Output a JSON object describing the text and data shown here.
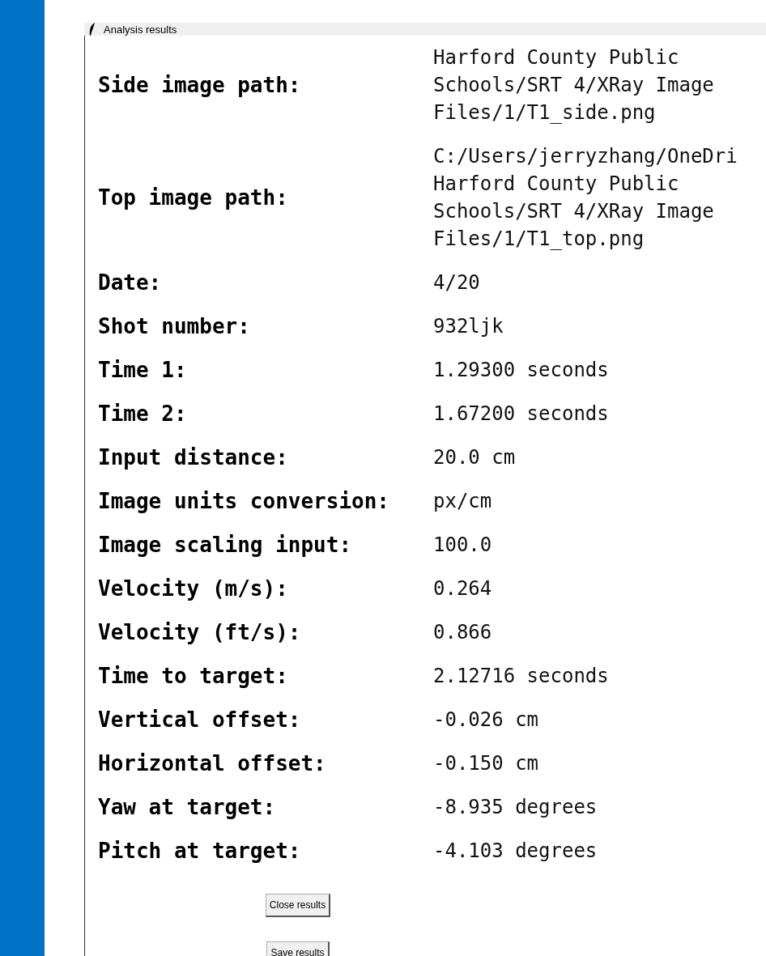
{
  "window": {
    "title": "Analysis results"
  },
  "rows": [
    {
      "label": "Side image path:",
      "value": [
        "Harford County Public",
        "Schools/SRT 4/XRay Image",
        "Files/1/T1_side.png"
      ]
    },
    {
      "label": "Top image path:",
      "value": [
        "C:/Users/jerryzhang/OneDri",
        "Harford County Public",
        "Schools/SRT 4/XRay Image",
        "Files/1/T1_top.png"
      ]
    },
    {
      "label": "Date:",
      "value": [
        "4/20"
      ]
    },
    {
      "label": "Shot number:",
      "value": [
        "932ljk"
      ]
    },
    {
      "label": "Time 1:",
      "value": [
        "1.29300 seconds"
      ]
    },
    {
      "label": "Time 2:",
      "value": [
        "1.67200 seconds"
      ]
    },
    {
      "label": "Input distance:",
      "value": [
        "20.0 cm"
      ]
    },
    {
      "label": "Image units conversion:",
      "value": [
        "px/cm"
      ]
    },
    {
      "label": "Image scaling input:",
      "value": [
        "100.0"
      ]
    },
    {
      "label": "Velocity (m/s):",
      "value": [
        "0.264"
      ]
    },
    {
      "label": "Velocity (ft/s):",
      "value": [
        "0.866"
      ]
    },
    {
      "label": "Time to target:",
      "value": [
        "2.12716 seconds"
      ]
    },
    {
      "label": "Vertical offset:",
      "value": [
        "-0.026 cm"
      ]
    },
    {
      "label": "Horizontal offset:",
      "value": [
        "-0.150 cm"
      ]
    },
    {
      "label": "Yaw at target:",
      "value": [
        "-8.935 degrees"
      ]
    },
    {
      "label": "Pitch at target:",
      "value": [
        "-4.103 degrees"
      ]
    }
  ],
  "buttons": [
    "Close results",
    "Save results"
  ]
}
